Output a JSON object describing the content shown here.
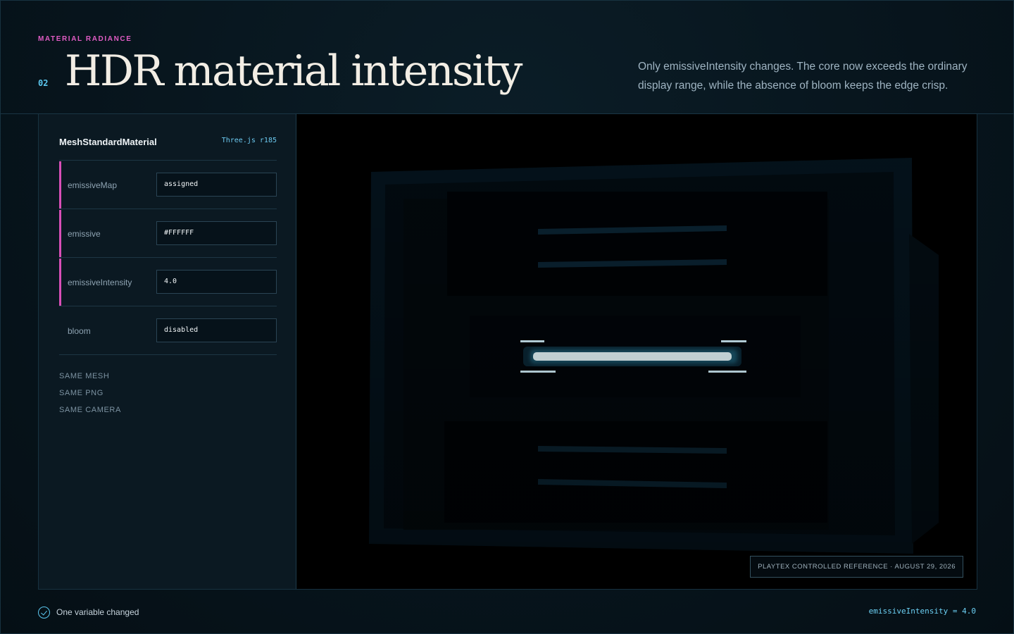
{
  "header": {
    "eyebrow": "MATERIAL RADIANCE",
    "index": "02",
    "title": "HDR material intensity",
    "subtitle": "Only emissiveIntensity changes. The core now exceeds the ordinary display range, while the absence of bloom keeps the edge crisp."
  },
  "panel": {
    "title": "MeshStandardMaterial",
    "version": "Three.js r185",
    "rows": [
      {
        "label": "emissiveMap",
        "value": "assigned",
        "accent": true
      },
      {
        "label": "emissive",
        "value": "#FFFFFF",
        "accent": true
      },
      {
        "label": "emissiveIntensity",
        "value": "4.0",
        "accent": true
      },
      {
        "label": "bloom",
        "value": "disabled",
        "accent": false
      }
    ],
    "tags": [
      "SAME MESH",
      "SAME PNG",
      "SAME CAMERA"
    ]
  },
  "viewport": {
    "reference": "PLAYTEX CONTROLLED REFERENCE · AUGUST 29, 2026"
  },
  "footer": {
    "status": "One variable changed",
    "readout": "emissiveIntensity = 4.0"
  },
  "colors": {
    "accent_pink": "#d94fb8",
    "accent_cyan": "#5cc8f0",
    "glow_core": "#eafcff"
  }
}
